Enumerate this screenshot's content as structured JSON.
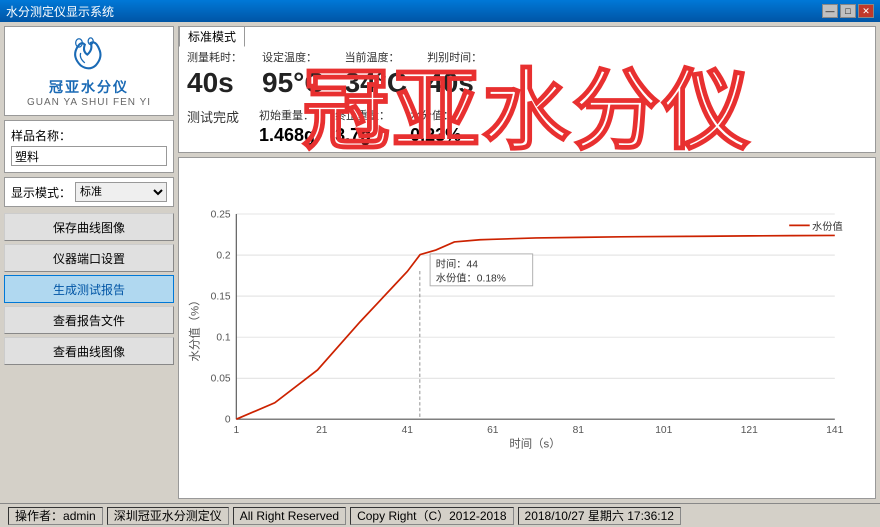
{
  "titlebar": {
    "title": "水分测定仪显示系统",
    "minimize": "—",
    "maximize": "□",
    "close": "✕"
  },
  "logo": {
    "text": "GUAN YA SHUI FEN YI",
    "label": "冠亚水分仪"
  },
  "sample": {
    "label": "样品名称：",
    "value": "塑料"
  },
  "mode": {
    "label": "显示模式：",
    "value": "标准"
  },
  "panel_tab": "标准模式",
  "measurement": {
    "time_label": "测量耗时：",
    "time_value": "40s",
    "temp_set_label": "设定温度：",
    "temp_set_value": "95°C",
    "temp_cur_label": "当前温度：",
    "temp_cur_value": "34°C",
    "judge_label": "判别时间：",
    "judge_value": "40s"
  },
  "measurement2": {
    "status_label": "测试完成",
    "init_weight_label": "初始重量：",
    "init_weight_value": "1.468g",
    "final_weight_label": "终止重量：",
    "final_weight_value": "3.7g",
    "moisture_label": "水分值：",
    "moisture_value": "0.23%"
  },
  "buttons": {
    "save_curve": "保存曲线图像",
    "port_settings": "仪器端口设置",
    "gen_report": "生成测试报告",
    "view_report": "查看报告文件",
    "view_curve": "查看曲线图像"
  },
  "chart": {
    "y_label": "水分值（%）",
    "x_label": "时间（s）",
    "tooltip_time": "时间：44",
    "tooltip_value": "水份值：0.18%",
    "legend": "水份值",
    "x_ticks": [
      1,
      21,
      41,
      61,
      81,
      101,
      121,
      141
    ],
    "y_ticks": [
      0,
      0.05,
      0.1,
      0.15,
      0.2,
      0.25
    ]
  },
  "watermark": "冠亚水分仪",
  "statusbar": {
    "operator_label": "操作者：",
    "operator": "admin",
    "company": "深圳冠亚水分测定仪",
    "rights": "All Right Reserved",
    "copyright": "Copy Right（C）2012-2018",
    "datetime": "2018/10/27 星期六 17:36:12"
  }
}
